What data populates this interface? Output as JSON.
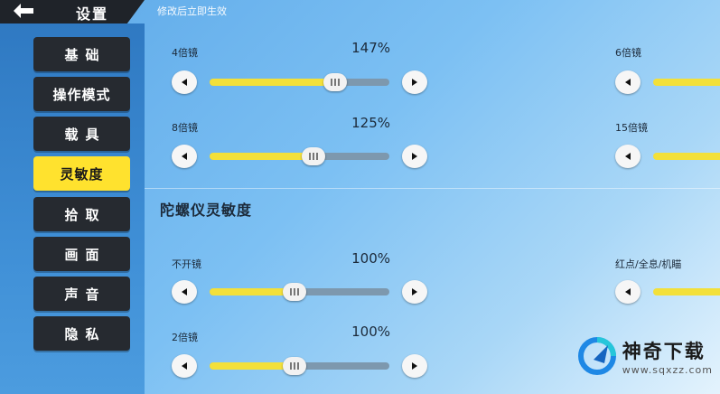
{
  "header": {
    "title": "设置",
    "notice": "修改后立即生效"
  },
  "sidebar": {
    "items": [
      {
        "label": "基础",
        "active": false
      },
      {
        "label": "操作模式",
        "active": false
      },
      {
        "label": "载具",
        "active": false
      },
      {
        "label": "灵敏度",
        "active": true
      },
      {
        "label": "拾取",
        "active": false
      },
      {
        "label": "画面",
        "active": false
      },
      {
        "label": "声音",
        "active": false
      },
      {
        "label": "隐私",
        "active": false
      }
    ]
  },
  "camera_section": {
    "left": [
      {
        "label": "4倍镜",
        "value_text": "147%",
        "level": 0.7
      },
      {
        "label": "8倍镜",
        "value_text": "125%",
        "level": 0.58
      }
    ],
    "right": [
      {
        "label": "6倍镜"
      },
      {
        "label": "15倍镜"
      }
    ]
  },
  "gyro_section": {
    "title": "陀螺仪灵敏度",
    "left": [
      {
        "label": "不开镜",
        "value_text": "100%",
        "level": 0.47
      },
      {
        "label": "2倍镜",
        "value_text": "100%",
        "level": 0.47
      }
    ],
    "right": [
      {
        "label": "红点/全息/机瞄"
      }
    ]
  },
  "watermark": {
    "main": "神奇下载",
    "sub": "www.sqxzz.com"
  },
  "colors": {
    "accent_yellow": "#ffe22e",
    "nav_dark": "#262a30",
    "track_grey": "#7d98ae"
  }
}
